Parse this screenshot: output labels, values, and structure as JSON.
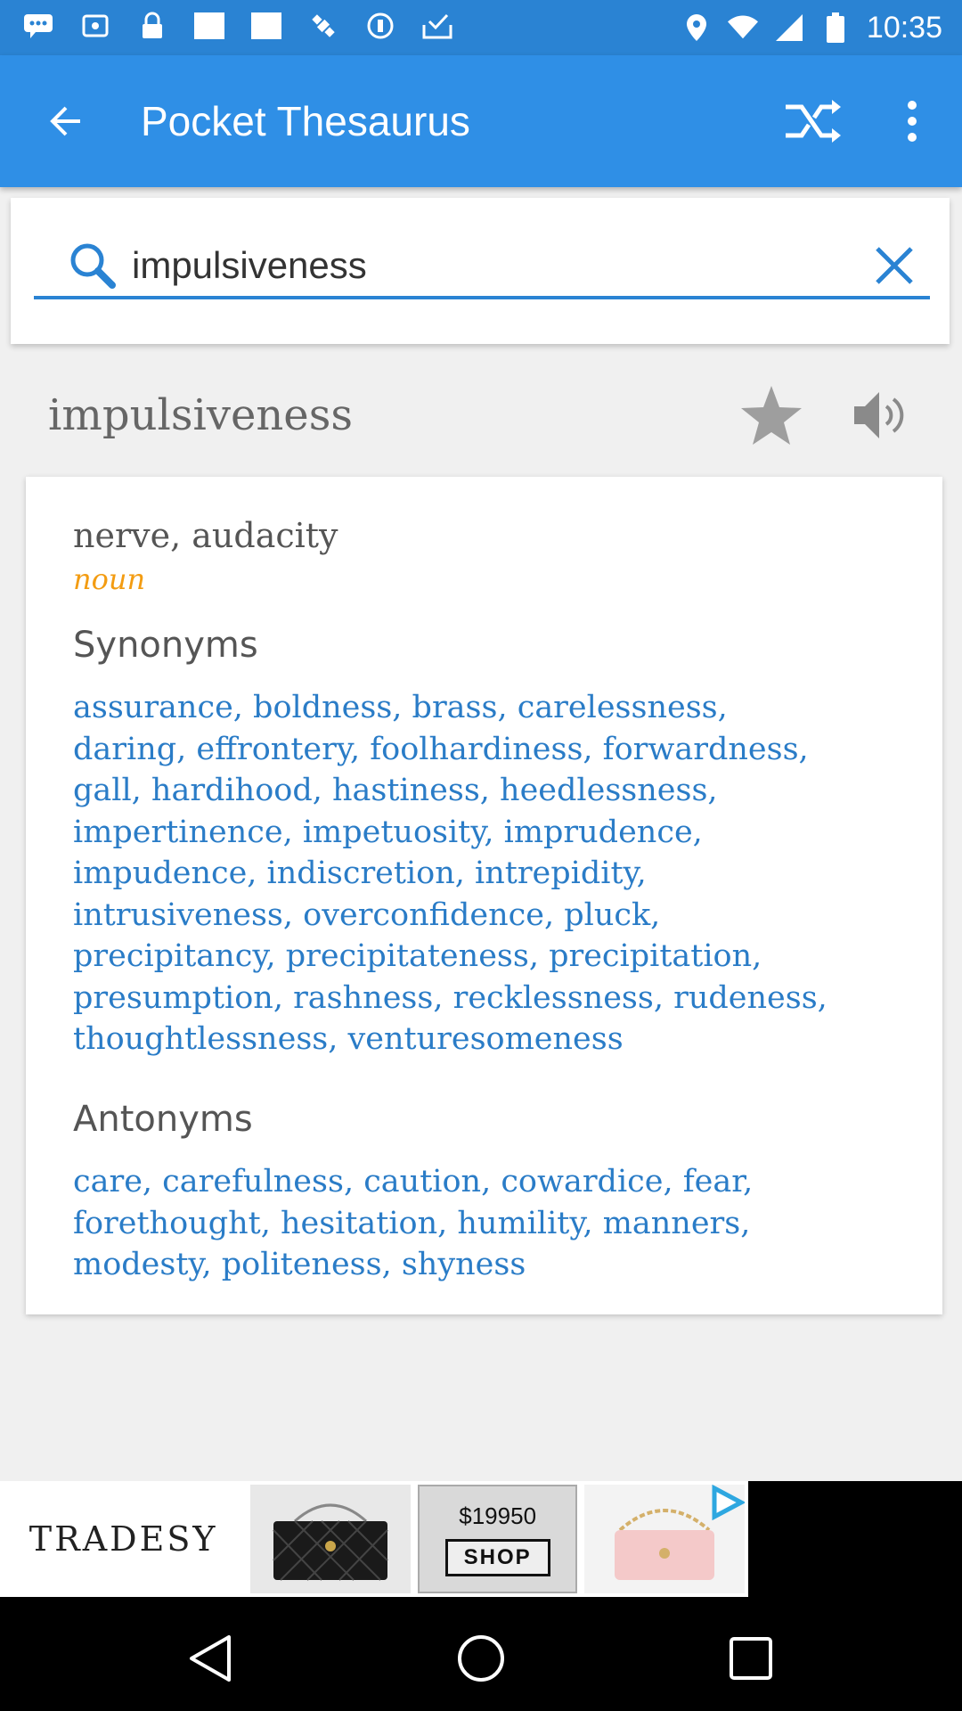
{
  "status_bar": {
    "time": "10:35",
    "left_icons": [
      "chat-bubble-icon",
      "notification-icon",
      "lock-icon",
      "square-icon",
      "square-icon",
      "satellite-icon",
      "data-icon",
      "check-tray-icon"
    ],
    "right_icons": [
      "location-icon",
      "wifi-icon",
      "signal-icon",
      "battery-icon"
    ]
  },
  "app_bar": {
    "title": "Pocket Thesaurus",
    "back_icon": "arrow-back-icon",
    "shuffle_icon": "shuffle-icon",
    "menu_icon": "more-vert-icon"
  },
  "search": {
    "value": "impulsiveness",
    "icon": "search-icon",
    "clear_icon": "close-icon"
  },
  "entry": {
    "word": "impulsiveness",
    "favorite_icon": "star-icon",
    "speak_icon": "volume-icon",
    "definition": "nerve, audacity",
    "part_of_speech": "noun",
    "synonyms_heading": "Synonyms",
    "synonyms": [
      "assurance, boldness, brass, carelessness,",
      "daring, effrontery, foolhardiness, forwardness,",
      "gall, hardihood, hastiness, heedlessness,",
      "impertinence, impetuosity, imprudence,",
      "impudence, indiscretion, intrepidity,",
      "intrusiveness, overconfidence, pluck,",
      "precipitancy, precipitateness, precipitation,",
      "presumption, rashness, recklessness, rudeness,",
      "thoughtlessness, venturesomeness"
    ],
    "antonyms_heading": "Antonyms",
    "antonyms": [
      "care, carefulness, caution, cowardice, fear,",
      "forethought, hesitation, humility, manners,",
      "modesty, politeness, shyness"
    ]
  },
  "ad": {
    "brand": "TRADESY",
    "price": "$19950",
    "shop_label": "SHOP",
    "play_icon": "ad-choices-icon"
  },
  "nav": {
    "back_icon": "nav-back-icon",
    "home_icon": "nav-home-icon",
    "recents_icon": "nav-recents-icon"
  },
  "colors": {
    "status_bar": "#2a83d3",
    "app_bar": "#2f8fe6",
    "link_blue": "#2a7cc7",
    "noun_orange": "#f39c12"
  }
}
